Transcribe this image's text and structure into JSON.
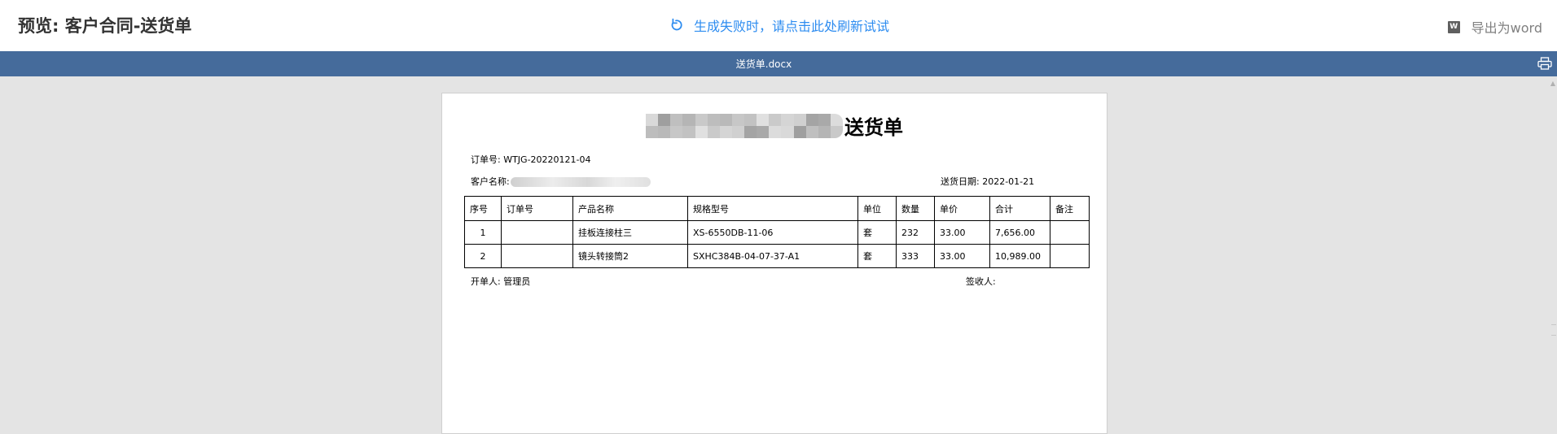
{
  "header": {
    "title": "预览: 客户合同-送货单",
    "refresh_label": "生成失败时，请点击此处刷新试试",
    "export_icon_text": "W",
    "export_label": "导出为word"
  },
  "file_bar": {
    "filename": "送货单.docx"
  },
  "document": {
    "title_suffix": "送货单",
    "order_no": "订单号: WTJG-20220121-04",
    "customer_label": "客户名称:",
    "delivery_date": "送货日期: 2022-01-21",
    "columns": [
      "序号",
      "订单号",
      "产品名称",
      "规格型号",
      "单位",
      "数量",
      "单价",
      "合计",
      "备注"
    ],
    "rows": [
      [
        "1",
        "",
        "挂板连接柱三",
        "XS-6550DB-11-06",
        "套",
        "232",
        "33.00",
        "7,656.00",
        ""
      ],
      [
        "2",
        "",
        "镜头转接筒2",
        "SXHC384B-04-07-37-A1",
        "套",
        "333",
        "33.00",
        "10,989.00",
        ""
      ]
    ],
    "issuer": "开单人: 管理员",
    "receiver": "签收人:"
  },
  "colors": {
    "accent": "#2d8cf0",
    "file_bar": "#456b9b",
    "viewer_bg": "#e4e4e4"
  }
}
